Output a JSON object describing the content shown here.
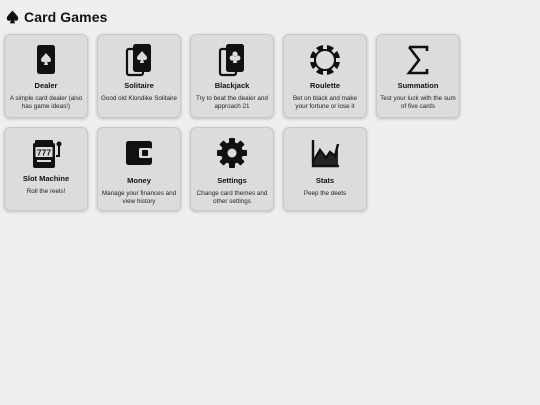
{
  "header": {
    "icon": "spade-icon",
    "title": "Card Games"
  },
  "cards": [
    {
      "icon": "spade-card-icon",
      "name": "Dealer",
      "desc": "A simple card dealer (also has game ideas!)"
    },
    {
      "icon": "stacked-spade-cards-icon",
      "name": "Solitaire",
      "desc": "Good old Klondike Solitaire"
    },
    {
      "icon": "stacked-club-cards-icon",
      "name": "Blackjack",
      "desc": "Try to beat the dealer and approach 21"
    },
    {
      "icon": "roulette-chip-icon",
      "name": "Roulette",
      "desc": "Bet on black and make your fortune or lose it"
    },
    {
      "icon": "sigma-icon",
      "name": "Summation",
      "desc": "Test your luck with the sum of five cards"
    },
    {
      "icon": "slot-machine-icon",
      "name": "Slot Machine",
      "desc": "Roll the reels!",
      "badge": "777"
    },
    {
      "icon": "wallet-icon",
      "name": "Money",
      "desc": "Manage your finances and view history"
    },
    {
      "icon": "gear-icon",
      "name": "Settings",
      "desc": "Change card themes and other settings"
    },
    {
      "icon": "chart-icon",
      "name": "Stats",
      "desc": "Peep the deets"
    }
  ]
}
